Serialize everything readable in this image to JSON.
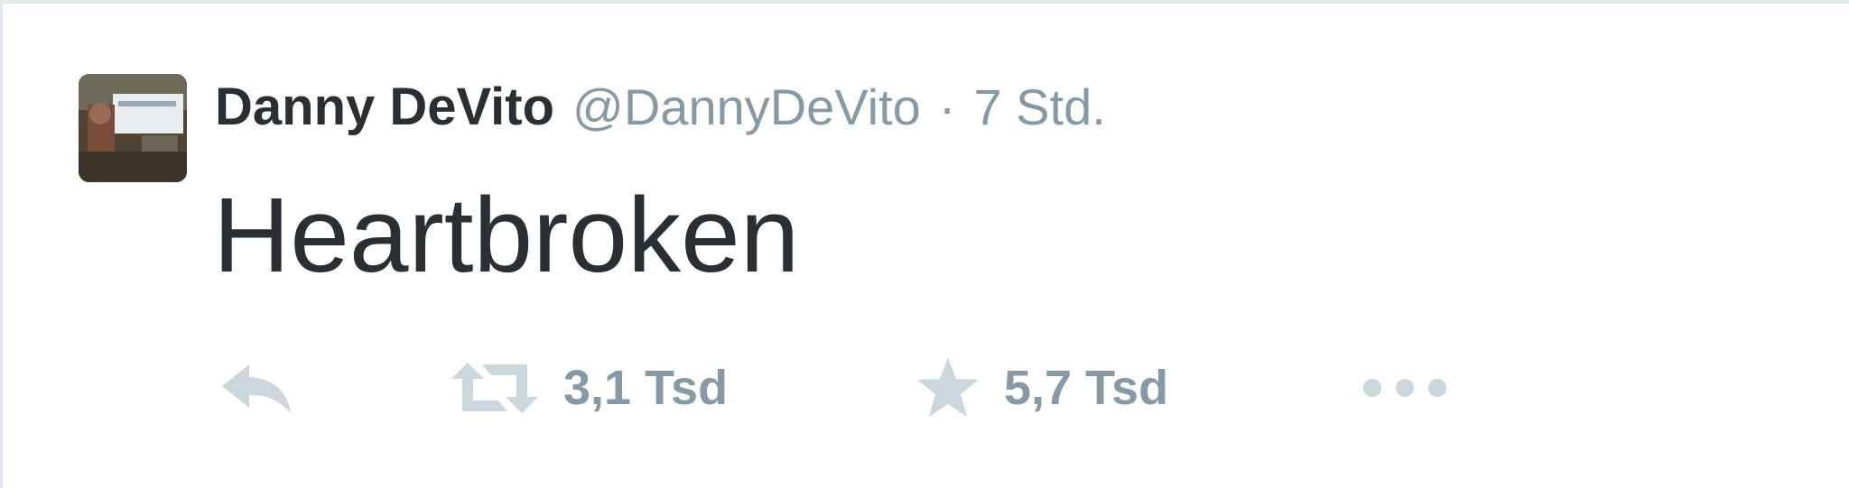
{
  "tweet": {
    "author_name": "Danny DeVito",
    "author_handle": "@DannyDeVito",
    "separator": "·",
    "timestamp": "7 Std.",
    "text": "Heartbroken",
    "actions": {
      "reply_icon": "reply-icon",
      "retweet_icon": "retweet-icon",
      "retweet_count": "3,1 Tsd",
      "favorite_icon": "star-icon",
      "favorite_count": "5,7 Tsd",
      "more_icon": "more-dots-icon"
    }
  },
  "colors": {
    "text": "#292f33",
    "muted": "#8899a6",
    "icon": "#ccd6dd",
    "border": "#e1e8ed"
  }
}
